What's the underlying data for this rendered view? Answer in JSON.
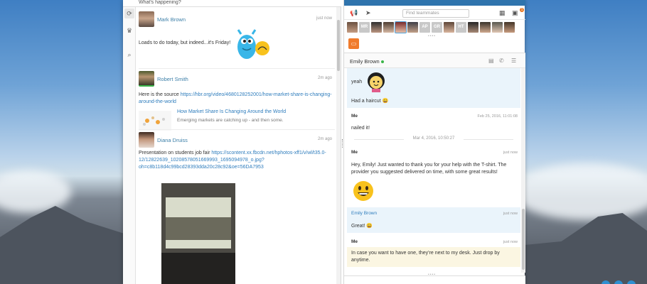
{
  "feed": {
    "prompt": "What's happening?",
    "posts": [
      {
        "author": "Mark Brown",
        "time": "just now",
        "text": "Loads to do today, but indeed...it's Friday!"
      },
      {
        "author": "Robert Smith",
        "time": "2m ago",
        "text_prefix": "Here is the source ",
        "link_line1": "https://hbr.org/video/4680128252001/how-market-share-is-changing-",
        "link_line2": "around-the-world",
        "preview_title": "How Market Share Is Changing Around the World",
        "preview_desc": "Emerging markets are catching up - and then some."
      },
      {
        "author": "Diana Druiss",
        "time": "2m ago",
        "text_prefix": "Presentation on students job fair ",
        "link_line1": "https://scontent.xx.fbcdn.net/hphotos-xff1/v/wl/t35.0-",
        "link_line2": "12/12822639_10208578051669993_1695094978_o.jpg?",
        "link_line3": "oh=c8b118d4c99bcd28393dda20c28c92&oe=56DA7953"
      }
    ]
  },
  "team": {
    "search_placeholder": "Find teammates",
    "badge": "1",
    "initials": [
      "MR",
      "AP",
      "GR",
      "HT"
    ]
  },
  "chat": {
    "contact": "Emily Brown",
    "messages": {
      "m1": "yeah",
      "m2": "Had a haircut 😀",
      "m3_sender": "Me",
      "m3_time": "Feb 25, 2016, 11:01:08",
      "m3_text": "nailed it!",
      "date_sep": "Mar 4, 2016, 10:50:27",
      "m4_sender": "Me",
      "m4_time": "just now",
      "m4_text_1": "Hey, Emily! Just wanted to thank you for your help with the T-shirt. The",
      "m4_text_2": "provider you suggested delivered on time, with some great results!",
      "m5_sender": "Emily Brown",
      "m5_time": "just now",
      "m5_text": "Great! 😀",
      "m6_sender": "Me",
      "m6_time": "just now",
      "m6_text_1": "In case you want to have one, they're next to my desk. Just drop by",
      "m6_text_2": "anytime."
    }
  },
  "icons": {
    "rail": [
      "refresh-icon",
      "crown-icon",
      "search-icon"
    ],
    "toolbar": [
      "megaphone-icon",
      "send-icon",
      "grid-icon",
      "chat-icon"
    ],
    "header": [
      "video-icon",
      "phone-icon",
      "menu-icon"
    ]
  },
  "colors": {
    "accent": "#2f74ad",
    "link": "#2f7dbd",
    "online": "#3bb54a",
    "notify": "#e87722"
  }
}
